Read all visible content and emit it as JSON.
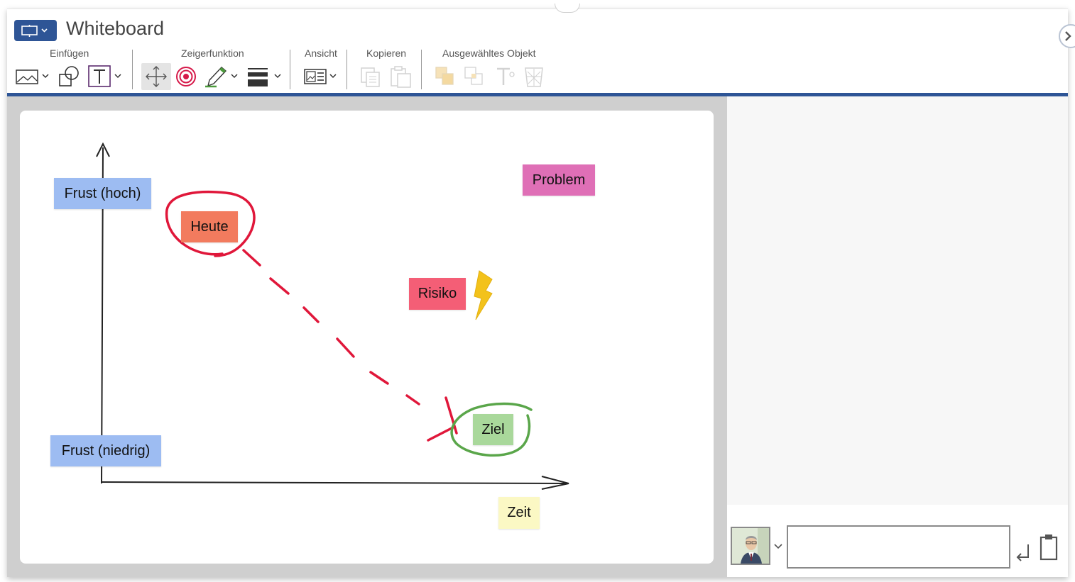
{
  "header": {
    "title": "Whiteboard",
    "groups": {
      "insert": "Einfügen",
      "pointer": "Zeigerfunktion",
      "view": "Ansicht",
      "copy": "Kopieren",
      "selected": "Ausgewähltes Objekt"
    }
  },
  "toolbar": {
    "insert_image": "image-icon",
    "insert_shape": "shapes-icon",
    "insert_text": "text-icon",
    "pointer_move": "move-arrows-icon",
    "pointer_target": "target-icon",
    "pointer_pen": "pen-icon",
    "pointer_lines": "line-weight-icon",
    "view": "view-layout-icon",
    "copy": [
      "copy-icon",
      "paste-icon"
    ],
    "selected": [
      "bring-to-front-icon",
      "send-to-back-icon",
      "text-format-icon",
      "delete-icon"
    ]
  },
  "board": {
    "notes": {
      "frust_hoch": "Frust (hoch)",
      "frust_niedrig": "Frust (niedrig)",
      "heute": "Heute",
      "ziel": "Ziel",
      "problem": "Problem",
      "risiko": "Risiko",
      "zeit": "Zeit"
    }
  },
  "colors": {
    "accent": "#2e5596",
    "note_blue": "#9dbcf2",
    "note_orange": "#f27b5e",
    "note_green": "#a9d89b",
    "note_pink": "#df6fb6",
    "note_red": "#f45e76",
    "note_yellow": "#fbf8c4",
    "ink_red": "#e0173a",
    "ink_green": "#5aa64a",
    "bolt_yellow": "#f3c21b"
  },
  "chat": {
    "input_value": "",
    "send_icon": "enter-arrow-icon",
    "clipboard_icon": "clipboard-icon"
  }
}
